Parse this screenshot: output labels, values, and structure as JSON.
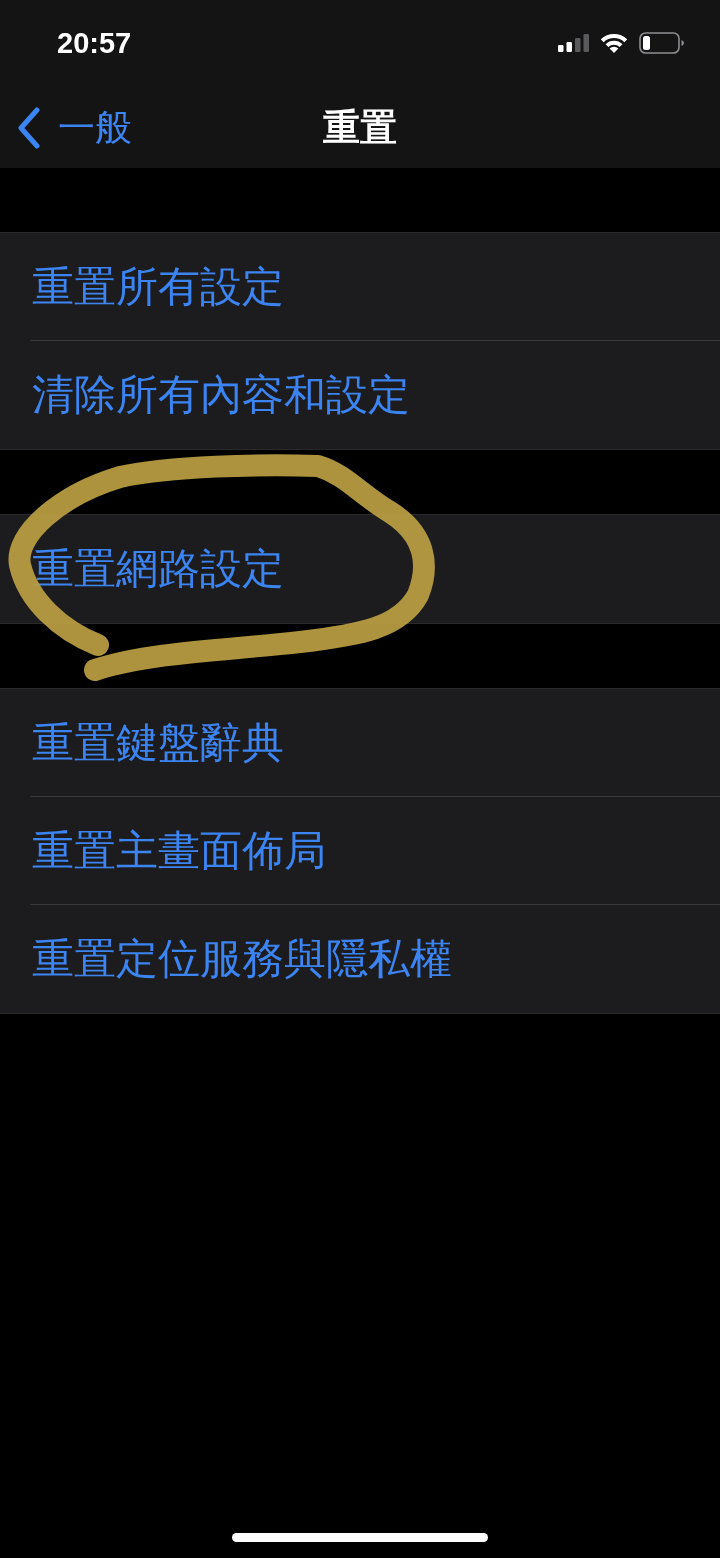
{
  "status_bar": {
    "time": "20:57"
  },
  "nav_bar": {
    "back_label": "一般",
    "title": "重置"
  },
  "groups": [
    {
      "items": [
        {
          "label": "重置所有設定",
          "circled": false
        },
        {
          "label": "清除所有內容和設定",
          "circled": false
        }
      ]
    },
    {
      "items": [
        {
          "label": "重置網路設定",
          "circled": true
        }
      ]
    },
    {
      "items": [
        {
          "label": "重置鍵盤辭典",
          "circled": false
        },
        {
          "label": "重置主畫面佈局",
          "circled": false
        },
        {
          "label": "重置定位服務與隱私權",
          "circled": false
        }
      ]
    }
  ]
}
